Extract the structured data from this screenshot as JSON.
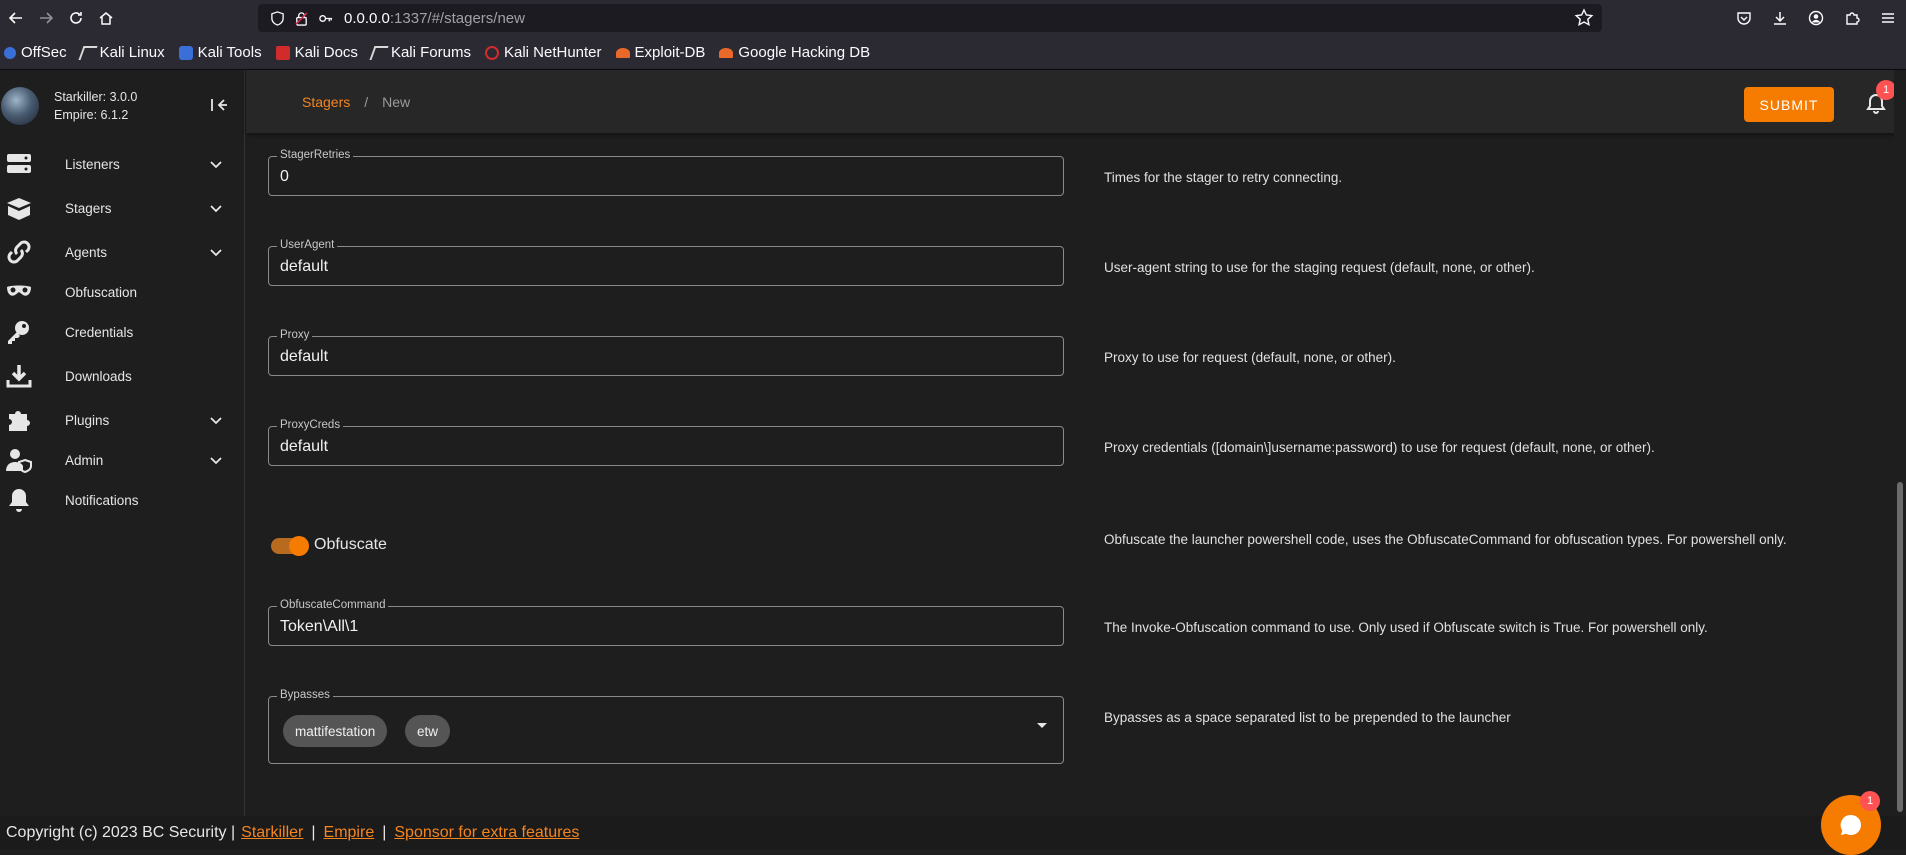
{
  "browser": {
    "url_host": "0.0.0.0",
    "url_rest": ":1337/#/stagers/new",
    "bookmarks": [
      {
        "label": "OffSec",
        "color": "#3b6fd8"
      },
      {
        "label": "Kali Linux",
        "color": "#d9d9d9"
      },
      {
        "label": "Kali Tools",
        "color": "#3b6fd8"
      },
      {
        "label": "Kali Docs",
        "color": "#d12b2b"
      },
      {
        "label": "Kali Forums",
        "color": "#d9d9d9"
      },
      {
        "label": "Kali NetHunter",
        "color": "#d12b2b"
      },
      {
        "label": "Exploit-DB",
        "color": "#e8692a"
      },
      {
        "label": "Google Hacking DB",
        "color": "#e8692a"
      }
    ]
  },
  "sidebar": {
    "app_name": "Starkiller: 3.0.0",
    "empire_version": "Empire: 6.1.2",
    "items": [
      {
        "label": "Listeners",
        "icon": "server-icon",
        "expandable": true
      },
      {
        "label": "Stagers",
        "icon": "box-icon",
        "expandable": true
      },
      {
        "label": "Agents",
        "icon": "link-icon",
        "expandable": true
      },
      {
        "label": "Obfuscation",
        "icon": "mask-icon",
        "expandable": false
      },
      {
        "label": "Credentials",
        "icon": "key-icon",
        "expandable": false
      },
      {
        "label": "Downloads",
        "icon": "download-icon",
        "expandable": false
      },
      {
        "label": "Plugins",
        "icon": "puzzle-icon",
        "expandable": true
      },
      {
        "label": "Admin",
        "icon": "user-shield-icon",
        "expandable": true
      },
      {
        "label": "Notifications",
        "icon": "bell-icon",
        "expandable": false
      }
    ]
  },
  "header": {
    "breadcrumb_link": "Stagers",
    "breadcrumb_sep": "/",
    "breadcrumb_current": "New",
    "submit_label": "SUBMIT",
    "notification_count": "1"
  },
  "form": {
    "stager_retries": {
      "label": "StagerRetries",
      "value": "0",
      "description": "Times for the stager to retry connecting."
    },
    "user_agent": {
      "label": "UserAgent",
      "value": "default",
      "description": "User-agent string to use for the staging request (default, none, or other)."
    },
    "proxy": {
      "label": "Proxy",
      "value": "default",
      "description": "Proxy to use for request (default, none, or other)."
    },
    "proxy_creds": {
      "label": "ProxyCreds",
      "value": "default",
      "description": "Proxy credentials ([domain\\]username:password) to use for request (default, none, or other)."
    },
    "obfuscate": {
      "label": "Obfuscate",
      "enabled": true,
      "description": "Obfuscate the launcher powershell code, uses the ObfuscateCommand for obfuscation types. For powershell only."
    },
    "obfuscate_command": {
      "label": "ObfuscateCommand",
      "value": "Token\\All\\1",
      "description": "The Invoke-Obfuscation command to use. Only used if Obfuscate switch is True. For powershell only."
    },
    "bypasses": {
      "label": "Bypasses",
      "chips": [
        "mattifestation",
        "etw"
      ],
      "description": "Bypasses as a space separated list to be prepended to the launcher"
    }
  },
  "footer": {
    "copyright": "Copyright (c) 2023 BC Security |",
    "link_starkiller": "Starkiller",
    "sep": "|",
    "link_empire": "Empire",
    "link_sponsor": "Sponsor for extra features"
  },
  "chat": {
    "badge": "1"
  },
  "colors": {
    "accent": "#f57c00",
    "badge": "#ff5252"
  }
}
